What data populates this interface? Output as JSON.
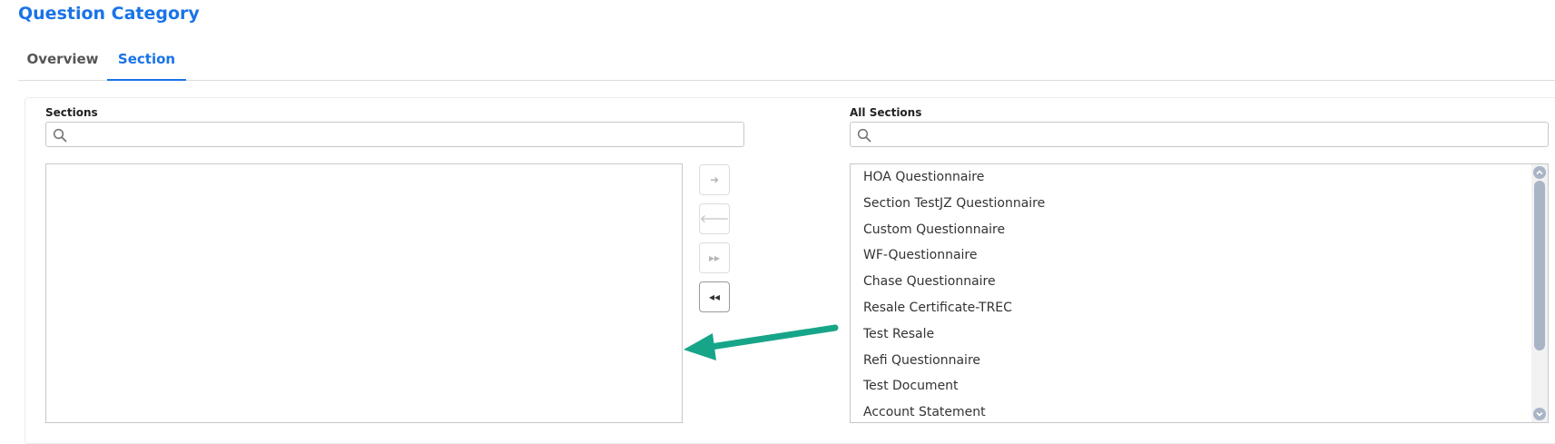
{
  "page": {
    "title": "Question Category"
  },
  "tabs": [
    {
      "label": "Overview",
      "active": false
    },
    {
      "label": "Section",
      "active": true
    }
  ],
  "sections": {
    "label": "Sections",
    "search_placeholder": "",
    "items": []
  },
  "all_sections": {
    "label": "All Sections",
    "search_placeholder": "",
    "items": [
      "HOA Questionnaire",
      "Section TestJZ Questionnaire",
      "Custom Questionnaire",
      "WF-Questionnaire",
      "Chase Questionnaire",
      "Resale Certificate-TREC",
      "Test Resale",
      "Refi Questionnaire",
      "Test Document",
      "Account Statement"
    ]
  },
  "transfer_buttons": [
    {
      "icon": "arrow-right-icon",
      "glyph": "➜",
      "enabled": false
    },
    {
      "icon": "arrow-left-icon",
      "glyph": "🡐",
      "enabled": false
    },
    {
      "icon": "double-arrow-right-icon",
      "glyph": "▸▸",
      "enabled": false
    },
    {
      "icon": "double-arrow-left-icon",
      "glyph": "◂◂",
      "enabled": true
    }
  ],
  "colors": {
    "accent": "#1a73e8",
    "annotation_arrow": "#17a589",
    "scroll_thumb": "#a9b4c7"
  }
}
